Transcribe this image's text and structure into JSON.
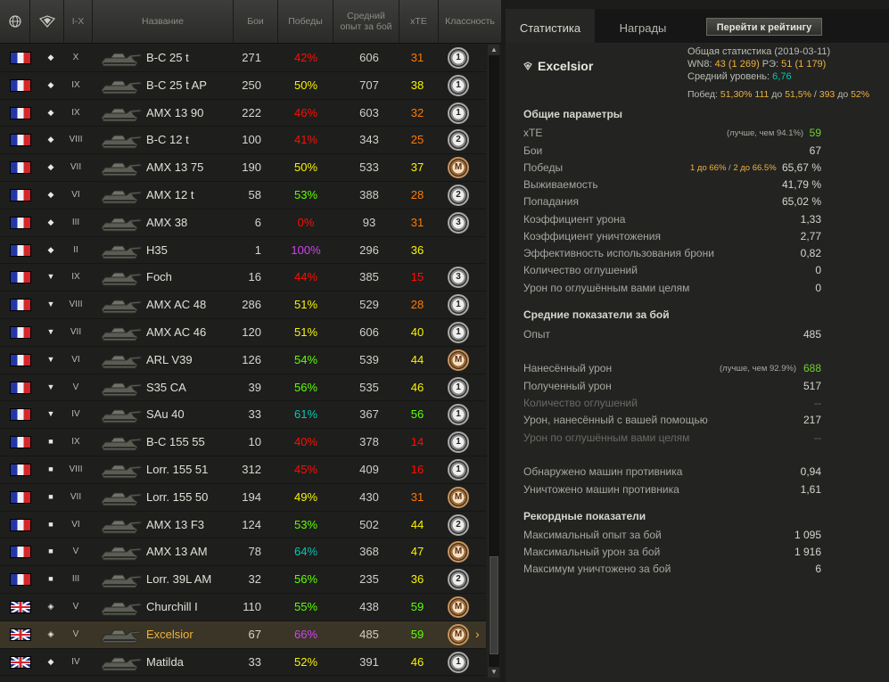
{
  "header": {
    "globe_icon": "globe-icon",
    "type_icon": "vehicle-type-icon",
    "tier_range": "I-X",
    "name": "Название",
    "battles": "Бои",
    "wins": "Победы",
    "avg_exp_line1": "Средний",
    "avg_exp_line2": "опыт за бой",
    "xte": "xTE",
    "mastery": "Классность"
  },
  "colors": {
    "red": "#fe0e00",
    "orange": "#fe7903",
    "yellow": "#f8f400",
    "green": "#60ff00",
    "teal": "#02c9b3",
    "purple": "#d042f3",
    "gold": "#f0b23a"
  },
  "tanks": [
    {
      "nation": "fr",
      "cls": "◆",
      "tier": "X",
      "name": "B-C 25 t",
      "battles": "271",
      "wins": "42%",
      "wins_color": "red",
      "avg_exp": "606",
      "xte": "31",
      "xte_color": "orange",
      "mastery": "1"
    },
    {
      "nation": "fr",
      "cls": "◆",
      "tier": "IX",
      "name": "B-C 25 t AP",
      "battles": "250",
      "wins": "50%",
      "wins_color": "yellow",
      "avg_exp": "707",
      "xte": "38",
      "xte_color": "yellow",
      "mastery": "1"
    },
    {
      "nation": "fr",
      "cls": "◆",
      "tier": "IX",
      "name": "AMX 13 90",
      "battles": "222",
      "wins": "46%",
      "wins_color": "red",
      "avg_exp": "603",
      "xte": "32",
      "xte_color": "orange",
      "mastery": "1"
    },
    {
      "nation": "fr",
      "cls": "◆",
      "tier": "VIII",
      "name": "B-C 12 t",
      "battles": "100",
      "wins": "41%",
      "wins_color": "red",
      "avg_exp": "343",
      "xte": "25",
      "xte_color": "orange",
      "mastery": "2"
    },
    {
      "nation": "fr",
      "cls": "◆",
      "tier": "VII",
      "name": "AMX 13 75",
      "battles": "190",
      "wins": "50%",
      "wins_color": "yellow",
      "avg_exp": "533",
      "xte": "37",
      "xte_color": "yellow",
      "mastery": "M"
    },
    {
      "nation": "fr",
      "cls": "◆",
      "tier": "VI",
      "name": "AMX 12 t",
      "battles": "58",
      "wins": "53%",
      "wins_color": "green",
      "avg_exp": "388",
      "xte": "28",
      "xte_color": "orange",
      "mastery": "2"
    },
    {
      "nation": "fr",
      "cls": "◆",
      "tier": "III",
      "name": "AMX 38",
      "battles": "6",
      "wins": "0%",
      "wins_color": "red",
      "avg_exp": "93",
      "xte": "31",
      "xte_color": "orange",
      "mastery": "3"
    },
    {
      "nation": "fr",
      "cls": "◆",
      "tier": "II",
      "name": "H35",
      "battles": "1",
      "wins": "100%",
      "wins_color": "purple",
      "avg_exp": "296",
      "xte": "36",
      "xte_color": "yellow",
      "mastery": ""
    },
    {
      "nation": "fr",
      "cls": "▼",
      "tier": "IX",
      "name": "Foch",
      "battles": "16",
      "wins": "44%",
      "wins_color": "red",
      "avg_exp": "385",
      "xte": "15",
      "xte_color": "red",
      "mastery": "3"
    },
    {
      "nation": "fr",
      "cls": "▼",
      "tier": "VIII",
      "name": "AMX AC 48",
      "battles": "286",
      "wins": "51%",
      "wins_color": "yellow",
      "avg_exp": "529",
      "xte": "28",
      "xte_color": "orange",
      "mastery": "1"
    },
    {
      "nation": "fr",
      "cls": "▼",
      "tier": "VII",
      "name": "AMX AC 46",
      "battles": "120",
      "wins": "51%",
      "wins_color": "yellow",
      "avg_exp": "606",
      "xte": "40",
      "xte_color": "yellow",
      "mastery": "1"
    },
    {
      "nation": "fr",
      "cls": "▼",
      "tier": "VI",
      "name": "ARL V39",
      "battles": "126",
      "wins": "54%",
      "wins_color": "green",
      "avg_exp": "539",
      "xte": "44",
      "xte_color": "yellow",
      "mastery": "M"
    },
    {
      "nation": "fr",
      "cls": "▼",
      "tier": "V",
      "name": "S35 CA",
      "battles": "39",
      "wins": "56%",
      "wins_color": "green",
      "avg_exp": "535",
      "xte": "46",
      "xte_color": "yellow",
      "mastery": "1"
    },
    {
      "nation": "fr",
      "cls": "▼",
      "tier": "IV",
      "name": "SAu 40",
      "battles": "33",
      "wins": "61%",
      "wins_color": "teal",
      "avg_exp": "367",
      "xte": "56",
      "xte_color": "green",
      "mastery": "1"
    },
    {
      "nation": "fr",
      "cls": "■",
      "tier": "IX",
      "name": "B-C 155 55",
      "battles": "10",
      "wins": "40%",
      "wins_color": "red",
      "avg_exp": "378",
      "xte": "14",
      "xte_color": "red",
      "mastery": "1"
    },
    {
      "nation": "fr",
      "cls": "■",
      "tier": "VIII",
      "name": "Lorr. 155 51",
      "battles": "312",
      "wins": "45%",
      "wins_color": "red",
      "avg_exp": "409",
      "xte": "16",
      "xte_color": "red",
      "mastery": "1"
    },
    {
      "nation": "fr",
      "cls": "■",
      "tier": "VII",
      "name": "Lorr. 155 50",
      "battles": "194",
      "wins": "49%",
      "wins_color": "yellow",
      "avg_exp": "430",
      "xte": "31",
      "xte_color": "orange",
      "mastery": "M"
    },
    {
      "nation": "fr",
      "cls": "■",
      "tier": "VI",
      "name": "AMX 13 F3",
      "battles": "124",
      "wins": "53%",
      "wins_color": "green",
      "avg_exp": "502",
      "xte": "44",
      "xte_color": "yellow",
      "mastery": "2"
    },
    {
      "nation": "fr",
      "cls": "■",
      "tier": "V",
      "name": "AMX 13 AM",
      "battles": "78",
      "wins": "64%",
      "wins_color": "teal",
      "avg_exp": "368",
      "xte": "47",
      "xte_color": "yellow",
      "mastery": "M"
    },
    {
      "nation": "fr",
      "cls": "■",
      "tier": "III",
      "name": "Lorr. 39L AM",
      "battles": "32",
      "wins": "56%",
      "wins_color": "green",
      "avg_exp": "235",
      "xte": "36",
      "xte_color": "yellow",
      "mastery": "2"
    },
    {
      "nation": "uk",
      "cls": "◈",
      "tier": "V",
      "name": "Churchill I",
      "battles": "110",
      "wins": "55%",
      "wins_color": "green",
      "avg_exp": "438",
      "xte": "59",
      "xte_color": "green",
      "mastery": "M"
    },
    {
      "nation": "uk",
      "cls": "◈",
      "tier": "V",
      "name": "Excelsior",
      "battles": "67",
      "wins": "66%",
      "wins_color": "purple",
      "avg_exp": "485",
      "xte": "59",
      "xte_color": "green",
      "mastery": "M",
      "selected": true
    },
    {
      "nation": "uk",
      "cls": "◆",
      "tier": "IV",
      "name": "Matilda",
      "battles": "33",
      "wins": "52%",
      "wins_color": "yellow",
      "avg_exp": "391",
      "xte": "46",
      "xte_color": "yellow",
      "mastery": "1"
    }
  ],
  "right": {
    "tab_stats": "Статистика",
    "tab_awards": "Награды",
    "rating_button": "Перейти к рейтингу",
    "vehicle_icon": "heavy-tank-icon",
    "vehicle_name": "Excelsior",
    "summary_title": "Общая статистика (2019-03-11)",
    "wn8_label": "WN8:",
    "wn8_value": "43",
    "wn8_rank": "(1 269)",
    "re_label": "РЭ:",
    "re_value": "51",
    "re_rank": "(1 179)",
    "avg_level_label": "Средний уровень:",
    "avg_level_value": "6,76",
    "wins_label": "Побед:",
    "wins_value": "51,30%",
    "wins_to1_count": "111",
    "wins_to1_label": "до",
    "wins_to1_target": "51,5%",
    "wins_sep": "/",
    "wins_to2_count": "393",
    "wins_to2_label": "до",
    "wins_to2_target": "52%",
    "sections": {
      "general": "Общие параметры",
      "average": "Средние показатели за бой",
      "records": "Рекордные показатели"
    },
    "general": {
      "xte_label": "xTE",
      "xte_note": "(лучше, чем 94.1%)",
      "xte_value": "59",
      "battles_label": "Бои",
      "battles_value": "67",
      "wins_label": "Победы",
      "wins_note_a": "1 до 66%",
      "wins_note_sep": "/",
      "wins_note_b": "2 до 66.5%",
      "wins_value": "65,67 %",
      "survival_label": "Выживаемость",
      "survival_value": "41,79 %",
      "hits_label": "Попадания",
      "hits_value": "65,02 %",
      "dmg_ratio_label": "Коэффициент урона",
      "dmg_ratio_value": "1,33",
      "kill_ratio_label": "Коэффициент уничтожения",
      "kill_ratio_value": "2,77",
      "armor_eff_label": "Эффективность использования брони",
      "armor_eff_value": "0,82",
      "stuns_label": "Количество оглушений",
      "stuns_value": "0",
      "stun_dmg_label": "Урон по оглушённым вами целям",
      "stun_dmg_value": "0"
    },
    "average": {
      "exp_label": "Опыт",
      "exp_value": "485",
      "dealt_label": "Нанесённый урон",
      "dealt_note": "(лучше, чем 92.9%)",
      "dealt_value": "688",
      "received_label": "Полученный урон",
      "received_value": "517",
      "stuns_label": "Количество оглушений",
      "stuns_value": "--",
      "assist_label": "Урон, нанесённый с вашей помощью",
      "assist_value": "217",
      "stun_dmg_label": "Урон по оглушённым вами целям",
      "stun_dmg_value": "--",
      "spotted_label": "Обнаружено машин противника",
      "spotted_value": "0,94",
      "destroyed_label": "Уничтожено машин противника",
      "destroyed_value": "1,61"
    },
    "records": {
      "max_exp_label": "Максимальный опыт за бой",
      "max_exp_value": "1 095",
      "max_dmg_label": "Максимальный урон за бой",
      "max_dmg_value": "1 916",
      "max_kills_label": "Максимум уничтожено за бой",
      "max_kills_value": "6"
    }
  }
}
